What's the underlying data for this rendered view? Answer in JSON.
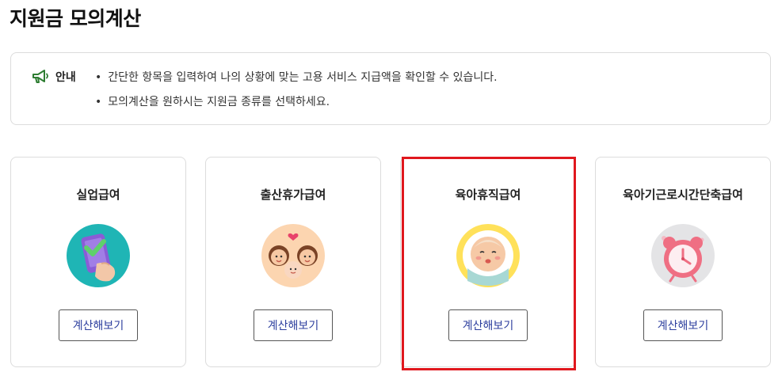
{
  "page": {
    "title": "지원금 모의계산"
  },
  "notice": {
    "icon": "megaphone-icon",
    "label": "안내",
    "lines": [
      "간단한 항목을 입력하여 나의 상황에 맞는 고용 서비스 지급액을 확인할 수 있습니다.",
      "모의계산을 원하시는 지원금 종류를 선택하세요."
    ]
  },
  "cards": [
    {
      "title": "실업급여",
      "illustration": "phone-check-icon",
      "button_label": "계산해보기"
    },
    {
      "title": "출산휴가급여",
      "illustration": "family-icon",
      "button_label": "계산해보기"
    },
    {
      "title": "육아휴직급여",
      "illustration": "baby-icon",
      "button_label": "계산해보기"
    },
    {
      "title": "육아기근로시간단축급여",
      "illustration": "alarm-clock-icon",
      "button_label": "계산해보기"
    }
  ],
  "colors": {
    "accent_green": "#2e7d32",
    "button_text": "#2c3e9e",
    "highlight_red": "#e0181e",
    "border": "#dcdcdc"
  }
}
